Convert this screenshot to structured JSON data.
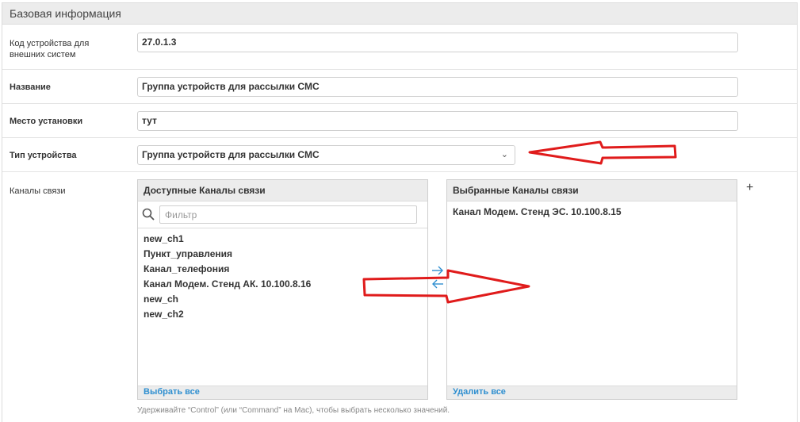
{
  "panel": {
    "title": "Базовая информация"
  },
  "fields": {
    "external_code": {
      "label": "Код устройства для внешних систем",
      "value": "27.0.1.3"
    },
    "name": {
      "label": "Название",
      "value": "Группа устройств для рассылки СМС"
    },
    "location": {
      "label": "Место установки",
      "value": "тут"
    },
    "device_type": {
      "label": "Тип устройства",
      "value": "Группа устройств для рассылки СМС"
    }
  },
  "channels": {
    "label": "Каналы связи",
    "available": {
      "title": "Доступные Каналы связи",
      "filter_placeholder": "Фильтр",
      "items": [
        "new_ch1",
        "Пункт_управления",
        "Канал_телефония",
        "Канал Модем. Стенд АК. 10.100.8.16",
        "new_ch",
        "new_ch2"
      ],
      "select_all": "Выбрать все"
    },
    "selected": {
      "title": "Выбранные Каналы связи",
      "items": [
        "Канал Модем. Стенд ЭС. 10.100.8.15"
      ],
      "remove_all": "Удалить все"
    },
    "add_symbol": "+",
    "hint": "Удерживайте “Control” (или “Command” на Mac), чтобы выбрать несколько значений."
  },
  "colors": {
    "accent_link": "#2f8fd0",
    "annotation_red": "#e01b1b",
    "header_bg": "#ececec"
  }
}
